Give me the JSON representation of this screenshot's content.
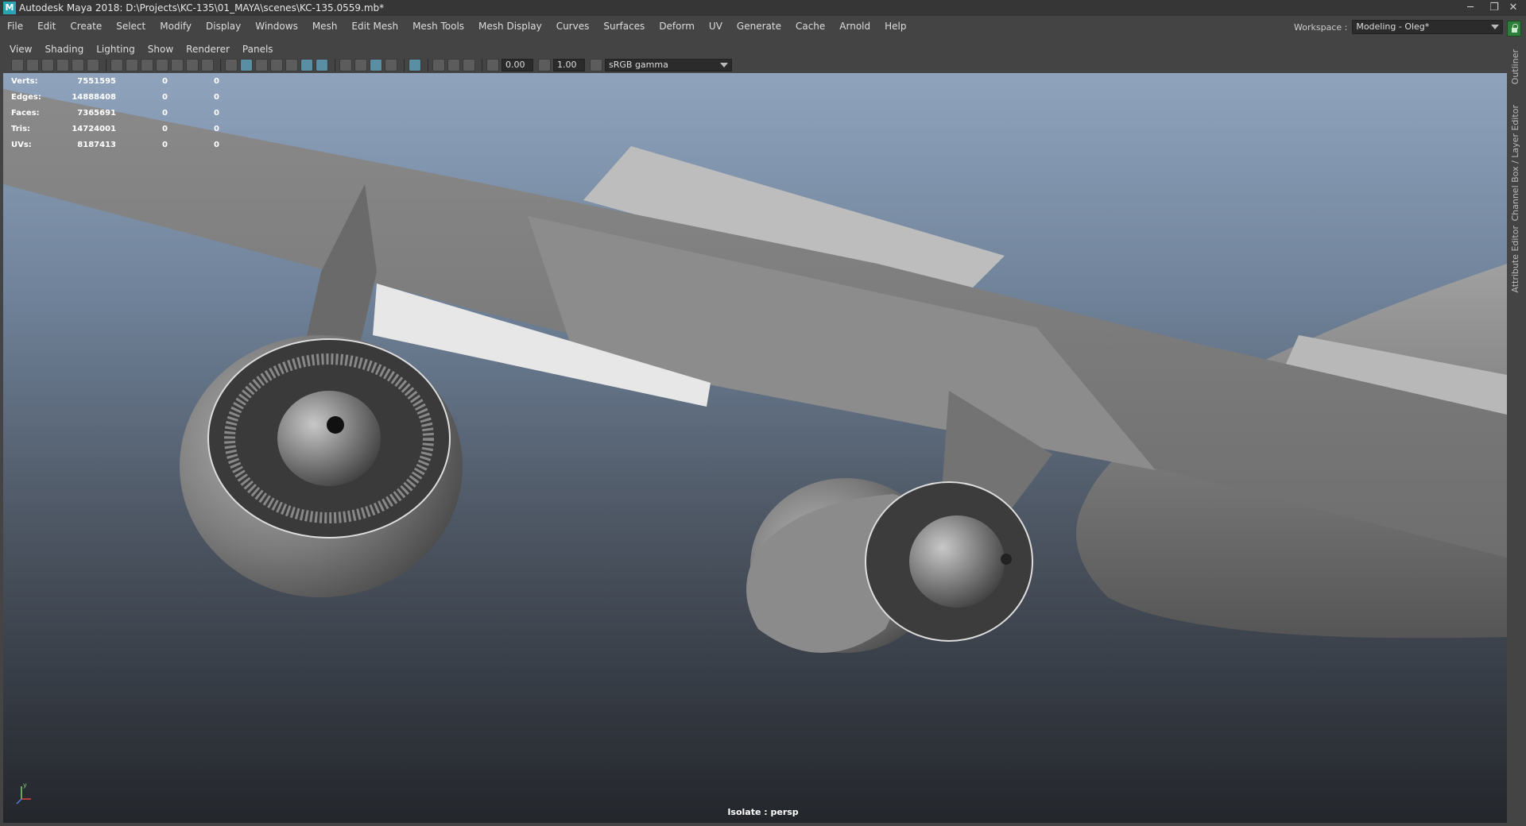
{
  "window": {
    "title": "Autodesk Maya 2018: D:\\Projects\\KC-135\\01_MAYA\\scenes\\KC-135.0559.mb*",
    "app_icon_letter": "M",
    "controls": {
      "minimize": "─",
      "restore": "❐",
      "close": "✕"
    }
  },
  "main_menu": [
    "File",
    "Edit",
    "Create",
    "Select",
    "Modify",
    "Display",
    "Windows",
    "Mesh",
    "Edit Mesh",
    "Mesh Tools",
    "Mesh Display",
    "Curves",
    "Surfaces",
    "Deform",
    "UV",
    "Generate",
    "Cache",
    "Arnold",
    "Help"
  ],
  "workspace": {
    "label": "Workspace :",
    "value": "Modeling - Oleg*"
  },
  "panel_menu": [
    "View",
    "Shading",
    "Lighting",
    "Show",
    "Renderer",
    "Panels"
  ],
  "panel_toolbar": {
    "exposure": "0.00",
    "gamma": "1.00",
    "color_space": "sRGB gamma"
  },
  "hud": {
    "rows": [
      {
        "label": "Verts:",
        "total": "7551595",
        "selected": "0",
        "triangles": "0"
      },
      {
        "label": "Edges:",
        "total": "14888408",
        "selected": "0",
        "triangles": "0"
      },
      {
        "label": "Faces:",
        "total": "7365691",
        "selected": "0",
        "triangles": "0"
      },
      {
        "label": "Tris:",
        "total": "14724001",
        "selected": "0",
        "triangles": "0"
      },
      {
        "label": "UVs:",
        "total": "8187413",
        "selected": "0",
        "triangles": "0"
      }
    ]
  },
  "viewport": {
    "camera_label": "Isolate : persp",
    "axis_y": "y"
  },
  "side_tabs": [
    "Outliner",
    "Channel Box / Layer Editor",
    "Attribute Editor"
  ],
  "colors": {
    "title_bg": "#363636",
    "ui_bg": "#444444",
    "accent": "#5a8fa3",
    "lock_green": "#2f7f3c"
  }
}
